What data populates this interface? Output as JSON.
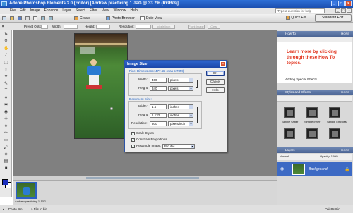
{
  "window": {
    "title": "Adobe Photoshop Elements 3.0 (Editor) [Andrew practicing 1.JPG @ 33.7% (RGB/8)]"
  },
  "menu": [
    "File",
    "Edit",
    "Image",
    "Enhance",
    "Layer",
    "Select",
    "Filter",
    "View",
    "Window",
    "Help"
  ],
  "help": {
    "placeholder": "Type a question for help"
  },
  "shortcuts": {
    "create": "Create",
    "photo_browser": "Photo Browser",
    "date_view": "Date View",
    "quick_fix": "Quick Fix",
    "standard_edit": "Standard Edit"
  },
  "options": {
    "preset": "Preset Options:",
    "width": "Width:",
    "height": "Height:",
    "resolution": "Resolution:",
    "resolution_unit": "pixels/inch",
    "front_image": "Front Image",
    "clear": "Clear"
  },
  "dialog": {
    "title": "Image Size",
    "pixel_dimensions": "Pixel Dimensions: 477.6K (was 5.78M)",
    "width_label": "Width:",
    "width_value": "400",
    "width_unit": "pixels",
    "height_label": "Height:",
    "height_value": "340",
    "height_unit": "pixels",
    "document_size": "Document Size:",
    "doc_width_label": "Width:",
    "doc_width_value": "1.6",
    "doc_width_unit": "inches",
    "doc_height_label": "Height:",
    "doc_height_value": "1.132",
    "doc_height_unit": "inches",
    "resolution_label": "Resolution:",
    "resolution_value": "300",
    "resolution_unit": "pixels/inch",
    "scale_styles": "Scale Styles",
    "constrain": "Constrain Proportions",
    "resample": "Resample Image:",
    "resample_method": "Bicubic",
    "ok": "OK",
    "cancel": "Cancel",
    "help": "Help"
  },
  "bin": {
    "caption": "Andrew practicing 1.JPG"
  },
  "status": {
    "photo_bin": "Photo Bin",
    "files_in_bin": "1 File in bin",
    "palette_bin": "Palette Bin"
  },
  "palette": {
    "how_to": "How To",
    "how_to_text_red": "Learn more by clicking through these How To topics.",
    "how_to_link": "Adding Special Effects",
    "styles_and_effects": "Styles and Effects",
    "more": "MORE",
    "effect_items": [
      "Simple Outer",
      "Simple Inner",
      "Simple Emboss"
    ],
    "layers": "Layers",
    "layer_mode": "Normal",
    "layer_opacity": "Opacity: 100%",
    "layer_name": "Background"
  }
}
